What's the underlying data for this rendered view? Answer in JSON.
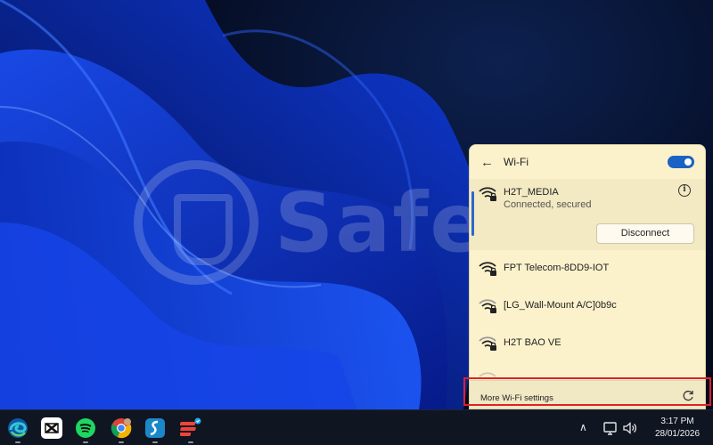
{
  "watermark": {
    "text": "Safe"
  },
  "wifi_panel": {
    "title": "Wi-Fi",
    "toggle_on": true,
    "accent_color": "#1a62c4",
    "connected": {
      "name": "H2T_MEDIA",
      "status": "Connected, secured",
      "disconnect_label": "Disconnect"
    },
    "networks": [
      {
        "name": "FPT Telecom-8DD9-IOT"
      },
      {
        "name": "[LG_Wall-Mount A/C]0b9c"
      },
      {
        "name": "H2T BAO VE"
      }
    ],
    "more_settings_label": "More Wi-Fi settings",
    "highlight_color": "#e0202a"
  },
  "taskbar": {
    "apps": [
      "edge-icon",
      "capcut-icon",
      "spotify-icon",
      "chrome-icon",
      "simplenote-icon",
      "anydesk-icon"
    ],
    "time": "3:17 PM",
    "date": "28/01/2026"
  }
}
